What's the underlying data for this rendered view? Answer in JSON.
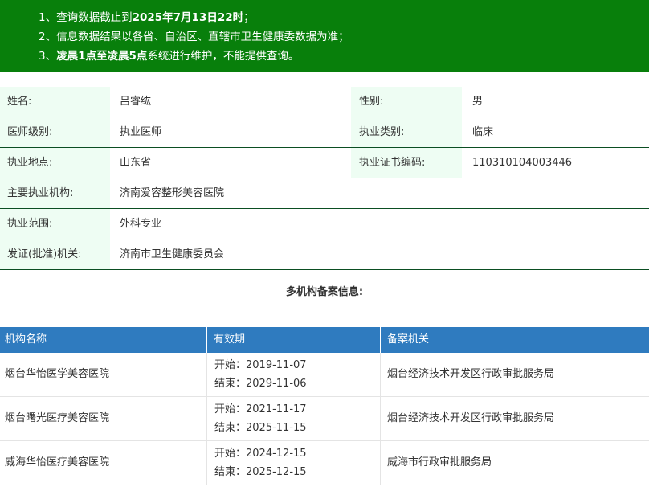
{
  "notice": {
    "line1_prefix": "1、查询数据截止到",
    "line1_bold": "2025年7月13日22时",
    "line1_suffix": "；",
    "line2": "2、信息数据结果以各省、自治区、直辖市卫生健康委数据为准；",
    "line3_prefix": "3、",
    "line3_bold": "凌晨1点至凌晨5点",
    "line3_suffix": "系统进行维护，不能提供查询。"
  },
  "info": {
    "name_label": "姓名:",
    "name_value": "吕睿纮",
    "gender_label": "性别:",
    "gender_value": "男",
    "level_label": "医师级别:",
    "level_value": "执业医师",
    "type_label": "执业类别:",
    "type_value": "临床",
    "location_label": "执业地点:",
    "location_value": "山东省",
    "cert_label": "执业证书编码:",
    "cert_value": "110310104003446",
    "org_label": "主要执业机构:",
    "org_value": "济南爱容整形美容医院",
    "scope_label": "执业范围:",
    "scope_value": "外科专业",
    "issuer_label": "发证(批准)机关:",
    "issuer_value": "济南市卫生健康委员会"
  },
  "multi_title": "多机构备案信息:",
  "table": {
    "headers": [
      "机构名称",
      "有效期",
      "备案机关"
    ],
    "rows": [
      {
        "org": "烟台华怡医学美容医院",
        "start": "开始：2019-11-07",
        "end": "结束：2029-11-06",
        "authority": "烟台经济技术开发区行政审批服务局"
      },
      {
        "org": "烟台曙光医疗美容医院",
        "start": "开始：2021-11-17",
        "end": "结束：2025-11-15",
        "authority": "烟台经济技术开发区行政审批服务局"
      },
      {
        "org": "威海华怡医疗美容医院",
        "start": "开始：2024-12-15",
        "end": "结束：2025-12-15",
        "authority": "威海市行政审批服务局"
      }
    ]
  },
  "colors": {
    "notice_bg": "#087f0b",
    "label_bg": "#eefdf3",
    "table_header_bg": "#2f7bbf"
  }
}
